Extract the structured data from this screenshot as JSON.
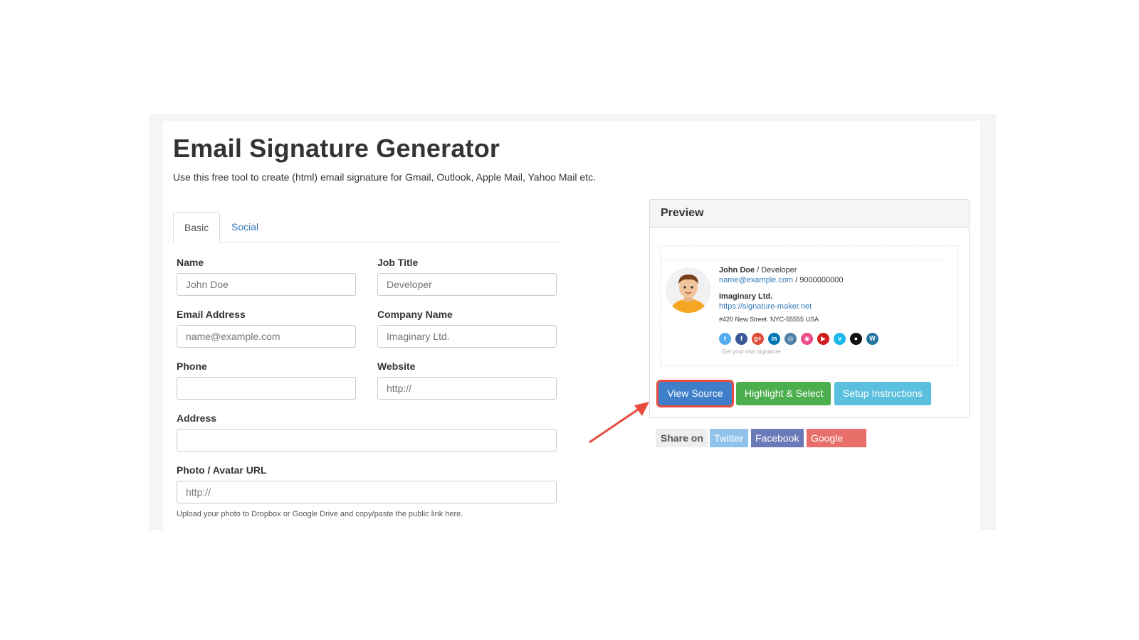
{
  "page": {
    "title": "Email Signature Generator",
    "subtitle": "Use this free tool to create (html) email signature for Gmail, Outlook, Apple Mail, Yahoo Mail etc."
  },
  "tabs": [
    {
      "label": "Basic",
      "active": true
    },
    {
      "label": "Social",
      "active": false
    }
  ],
  "form": {
    "name": {
      "label": "Name",
      "placeholder": "John Doe",
      "value": ""
    },
    "job_title": {
      "label": "Job Title",
      "placeholder": "Developer",
      "value": ""
    },
    "email": {
      "label": "Email Address",
      "placeholder": "name@example.com",
      "value": ""
    },
    "company": {
      "label": "Company Name",
      "placeholder": "Imaginary Ltd.",
      "value": ""
    },
    "phone": {
      "label": "Phone",
      "placeholder": "",
      "value": ""
    },
    "website": {
      "label": "Website",
      "placeholder": "http://",
      "value": ""
    },
    "address": {
      "label": "Address",
      "placeholder": "",
      "value": ""
    },
    "photo": {
      "label": "Photo / Avatar URL",
      "placeholder": "http://",
      "value": ""
    },
    "photo_help": "Upload your photo to Dropbox or Google Drive and copy/paste the public link here."
  },
  "preview": {
    "heading": "Preview",
    "name": "John Doe",
    "separator": " / ",
    "job": "Developer",
    "email": "name@example.com",
    "phone": "9000000000",
    "company": "Imaginary Ltd.",
    "website": "https://signature-maker.net",
    "address": "#420 New Street. NYC-55555 USA",
    "get_your_own": "Get your own signature",
    "social_icons": [
      {
        "name": "twitter-icon",
        "color": "#55acee",
        "glyph": "t"
      },
      {
        "name": "facebook-icon",
        "color": "#3b5998",
        "glyph": "f"
      },
      {
        "name": "google-plus-icon",
        "color": "#dd4b39",
        "glyph": "g+"
      },
      {
        "name": "linkedin-icon",
        "color": "#0077b5",
        "glyph": "in"
      },
      {
        "name": "instagram-icon",
        "color": "#517fa4",
        "glyph": "◎"
      },
      {
        "name": "dribbble-icon",
        "color": "#ea4c89",
        "glyph": "◉"
      },
      {
        "name": "youtube-icon",
        "color": "#cd201f",
        "glyph": "▶"
      },
      {
        "name": "vimeo-icon",
        "color": "#1ab7ea",
        "glyph": "v"
      },
      {
        "name": "github-icon",
        "color": "#111111",
        "glyph": "●"
      },
      {
        "name": "wordpress-icon",
        "color": "#21759b",
        "glyph": "W"
      }
    ]
  },
  "buttons": {
    "view_source": "View Source",
    "highlight": "Highlight & Select",
    "setup": "Setup Instructions"
  },
  "share": {
    "label": "Share on",
    "twitter": "Twitter",
    "facebook": "Facebook",
    "google_plus": "Google Plus"
  },
  "colors": {
    "primary": "#3f7ec9",
    "success": "#4cae4c",
    "info": "#5bc0de",
    "highlight_outline": "#e74c3c",
    "link": "#337ab7"
  }
}
